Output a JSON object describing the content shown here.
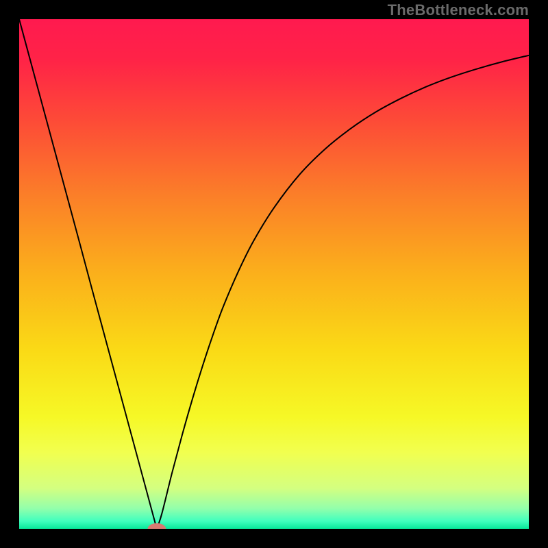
{
  "watermark": "TheBottleneck.com",
  "chart_data": {
    "type": "line",
    "title": "",
    "xlabel": "",
    "ylabel": "",
    "xlim": [
      0,
      100
    ],
    "ylim": [
      0,
      100
    ],
    "grid": false,
    "background": {
      "type": "vertical-gradient",
      "stops": [
        {
          "offset": 0.0,
          "color": "#ff1a4f"
        },
        {
          "offset": 0.08,
          "color": "#ff2347"
        },
        {
          "offset": 0.2,
          "color": "#fd4b37"
        },
        {
          "offset": 0.35,
          "color": "#fb8028"
        },
        {
          "offset": 0.5,
          "color": "#fbb01b"
        },
        {
          "offset": 0.65,
          "color": "#fada16"
        },
        {
          "offset": 0.78,
          "color": "#f6f826"
        },
        {
          "offset": 0.85,
          "color": "#f1ff4f"
        },
        {
          "offset": 0.92,
          "color": "#d4ff80"
        },
        {
          "offset": 0.96,
          "color": "#93ffab"
        },
        {
          "offset": 0.985,
          "color": "#40ffbe"
        },
        {
          "offset": 1.0,
          "color": "#08e89a"
        }
      ]
    },
    "series": [
      {
        "name": "bottleneck-curve",
        "color": "#000000",
        "stroke_width": 2,
        "x": [
          0,
          2,
          4,
          6,
          8,
          10,
          12,
          14,
          16,
          18,
          20,
          22,
          24,
          26,
          27,
          28,
          30,
          32,
          34,
          36,
          38,
          40,
          43,
          46,
          50,
          55,
          60,
          65,
          70,
          75,
          80,
          85,
          90,
          95,
          100
        ],
        "y": [
          100,
          92.6,
          85.2,
          77.8,
          70.4,
          63.0,
          55.6,
          48.1,
          40.7,
          33.3,
          25.9,
          18.5,
          11.1,
          3.7,
          0.0,
          3.0,
          11.0,
          18.5,
          25.5,
          32.0,
          38.0,
          43.5,
          50.5,
          56.5,
          63.0,
          69.5,
          74.5,
          78.5,
          81.8,
          84.5,
          86.8,
          88.7,
          90.3,
          91.7,
          92.9
        ]
      }
    ],
    "marker": {
      "name": "optimal-point",
      "x": 27,
      "y": 0,
      "rx": 1.8,
      "ry": 1.1,
      "color": "#d87a72"
    }
  }
}
